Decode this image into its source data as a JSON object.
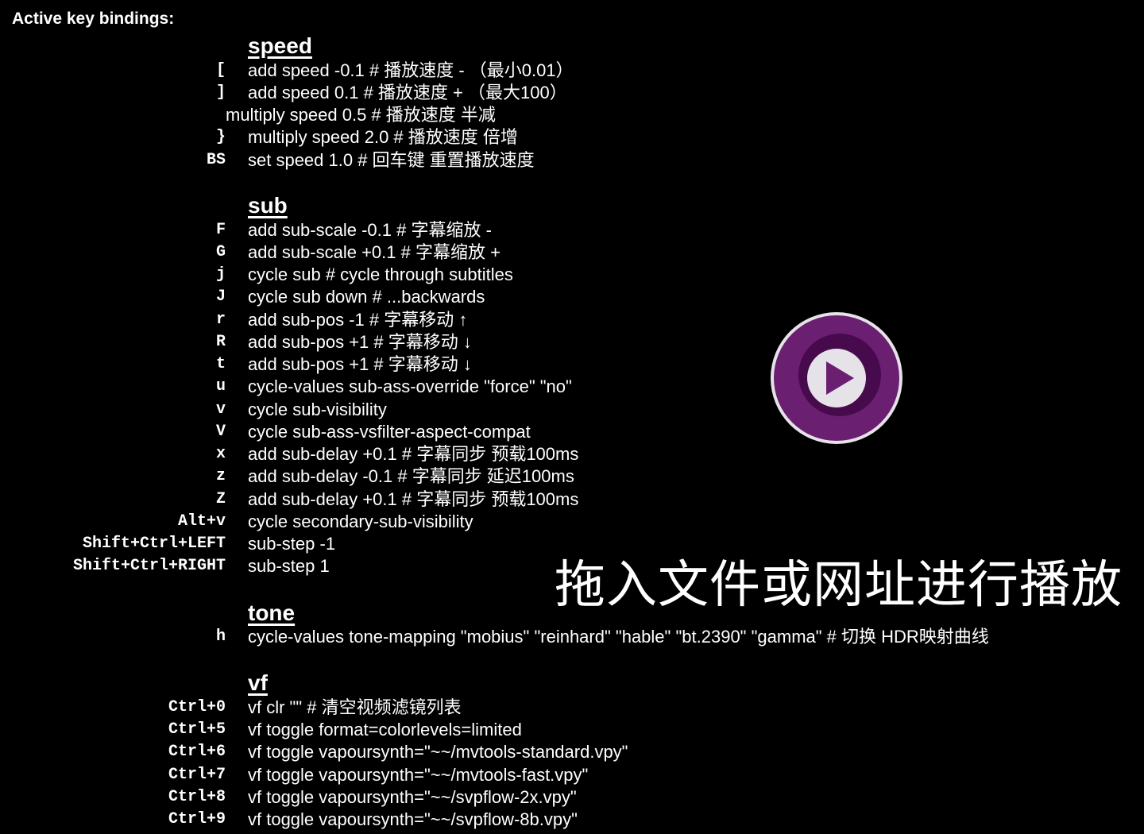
{
  "header": "Active key bindings:",
  "sections": [
    {
      "title": "speed",
      "rows": [
        {
          "key": "[",
          "command": "add speed -0.1  # 播放速度 - （最小0.01）"
        },
        {
          "key": "]",
          "command": "add speed  0.1  # 播放速度 + （最大100）"
        },
        {
          "key": "",
          "command": "multiply speed 0.5  # 播放速度 半减"
        },
        {
          "key": "}",
          "command": "multiply speed 2.0  # 播放速度 倍增"
        },
        {
          "key": "BS",
          "command": "set speed 1.0  # 回车键 重置播放速度"
        }
      ]
    },
    {
      "title": "sub",
      "rows": [
        {
          "key": "F",
          "command": "add sub-scale -0.1  # 字幕缩放 -"
        },
        {
          "key": "G",
          "command": "add sub-scale +0.1  # 字幕缩放 +"
        },
        {
          "key": "j",
          "command": "cycle sub  # cycle through subtitles"
        },
        {
          "key": "J",
          "command": "cycle sub down  # ...backwards"
        },
        {
          "key": "r",
          "command": "add sub-pos -1  # 字幕移动 ↑"
        },
        {
          "key": "R",
          "command": "add sub-pos +1  # 字幕移动 ↓"
        },
        {
          "key": "t",
          "command": "add sub-pos +1  # 字幕移动 ↓"
        },
        {
          "key": "u",
          "command": "cycle-values sub-ass-override \"force\" \"no\""
        },
        {
          "key": "v",
          "command": "cycle sub-visibility"
        },
        {
          "key": "V",
          "command": "cycle sub-ass-vsfilter-aspect-compat"
        },
        {
          "key": "x",
          "command": "add sub-delay +0.1  # 字幕同步 预载100ms"
        },
        {
          "key": "z",
          "command": "add sub-delay -0.1  # 字幕同步 延迟100ms"
        },
        {
          "key": "Z",
          "command": "add sub-delay +0.1  # 字幕同步 预载100ms"
        },
        {
          "key": "Alt+v",
          "command": "cycle secondary-sub-visibility"
        },
        {
          "key": "Shift+Ctrl+LEFT",
          "command": "sub-step -1"
        },
        {
          "key": "Shift+Ctrl+RIGHT",
          "command": "sub-step 1"
        }
      ]
    },
    {
      "title": "tone",
      "rows": [
        {
          "key": "h",
          "command": "cycle-values tone-mapping \"mobius\" \"reinhard\" \"hable\" \"bt.2390\" \"gamma\"  # 切换 HDR映射曲线"
        }
      ]
    },
    {
      "title": "vf",
      "rows": [
        {
          "key": "Ctrl+0",
          "command": "vf clr \"\"  # 清空视频滤镜列表"
        },
        {
          "key": "Ctrl+5",
          "command": "vf toggle format=colorlevels=limited"
        },
        {
          "key": "Ctrl+6",
          "command": "vf toggle vapoursynth=\"~~/mvtools-standard.vpy\""
        },
        {
          "key": "Ctrl+7",
          "command": "vf toggle vapoursynth=\"~~/mvtools-fast.vpy\""
        },
        {
          "key": "Ctrl+8",
          "command": "vf toggle vapoursynth=\"~~/svpflow-2x.vpy\""
        },
        {
          "key": "Ctrl+9",
          "command": "vf toggle vapoursynth=\"~~/svpflow-8b.vpy\""
        }
      ]
    }
  ],
  "drop_hint": "拖入文件或网址进行播放",
  "logo_icon": "mpv-play-icon",
  "colors": {
    "background": "#000000",
    "text": "#ffffff",
    "logo_outer": "#e6e3e8",
    "logo_ring": "#6b1f71",
    "logo_inner": "#470a4d",
    "logo_play_circle": "#e6e3e8",
    "logo_play_triangle": "#6b1f71"
  }
}
